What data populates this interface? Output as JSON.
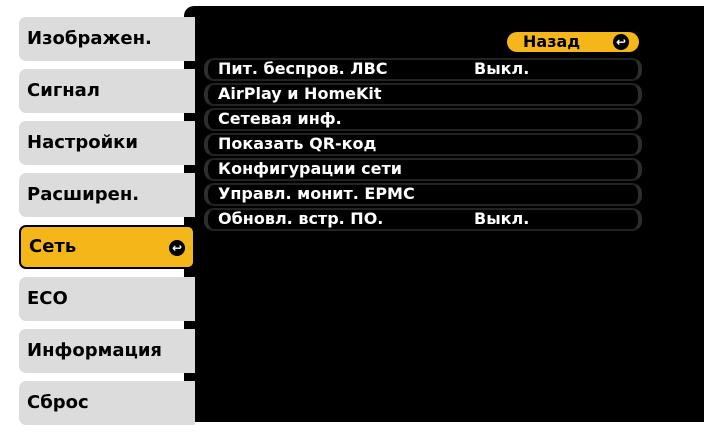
{
  "sidebar": {
    "items": [
      {
        "label": "Изображен."
      },
      {
        "label": "Сигнал"
      },
      {
        "label": "Настройки"
      },
      {
        "label": "Расширен."
      },
      {
        "label": "Сеть"
      },
      {
        "label": "ECO"
      },
      {
        "label": "Информация"
      },
      {
        "label": "Сброс"
      }
    ],
    "active_index": 4
  },
  "back_button": {
    "label": "Назад"
  },
  "menu": {
    "rows": [
      {
        "label": "Пит. беспров. ЛВС",
        "value": "Выкл."
      },
      {
        "label": "AirPlay и HomeKit",
        "value": ""
      },
      {
        "label": "Сетевая инф.",
        "value": ""
      },
      {
        "label": "Показать QR-код",
        "value": ""
      },
      {
        "label": "Конфигурации сети",
        "value": ""
      },
      {
        "label": "Управл. монит. EPMC",
        "value": ""
      },
      {
        "label": "Обновл. встр. ПО.",
        "value": "Выкл."
      }
    ]
  },
  "colors": {
    "accent": "#f5b61a",
    "panel": "#000000",
    "sidebar_item": "#dcdcdc"
  },
  "icons": {
    "enter": "enter-icon"
  }
}
